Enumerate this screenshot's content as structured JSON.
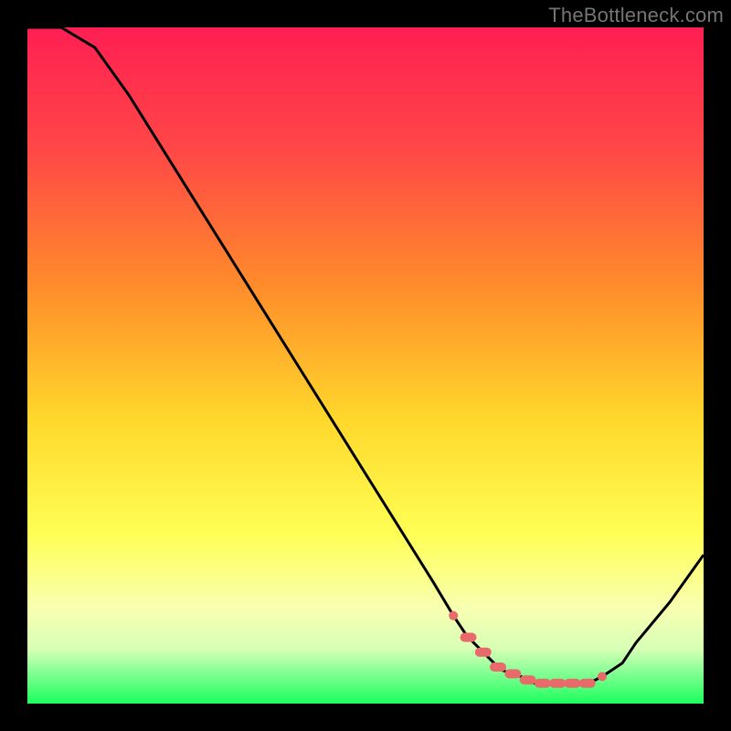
{
  "watermark": "TheBottleneck.com",
  "chart_data": {
    "type": "line",
    "title": "",
    "xlabel": "",
    "ylabel": "",
    "x": [
      0.0,
      0.05,
      0.1,
      0.15,
      0.2,
      0.25,
      0.3,
      0.35,
      0.4,
      0.45,
      0.5,
      0.55,
      0.6,
      0.63,
      0.65,
      0.68,
      0.7,
      0.73,
      0.75,
      0.78,
      0.8,
      0.83,
      0.85,
      0.88,
      0.9,
      0.95,
      1.0
    ],
    "y": [
      1.0,
      1.0,
      0.97,
      0.9,
      0.82,
      0.74,
      0.66,
      0.58,
      0.5,
      0.42,
      0.34,
      0.26,
      0.18,
      0.13,
      0.1,
      0.07,
      0.05,
      0.04,
      0.03,
      0.03,
      0.03,
      0.03,
      0.04,
      0.06,
      0.09,
      0.15,
      0.22
    ],
    "xlim": [
      0,
      1
    ],
    "ylim": [
      0,
      1
    ],
    "marked_region_x": [
      0.63,
      0.85
    ],
    "background_gradient": {
      "top": "#ff1f53",
      "mid_upper": "#ff8b2b",
      "mid": "#ffd82b",
      "mid_lower": "#ffff55",
      "low": "#f8ffb2",
      "bottom": "#1bff5e"
    },
    "marker_color": "#e96a6a",
    "line_color": "#000000"
  }
}
